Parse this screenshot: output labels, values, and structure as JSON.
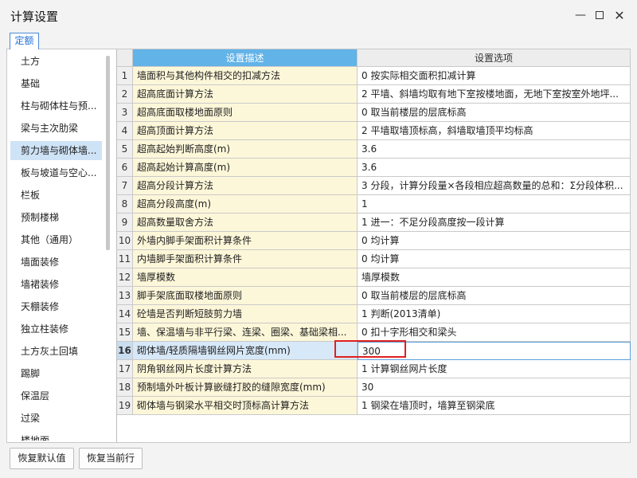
{
  "window": {
    "title": "计算设置"
  },
  "tab": {
    "label": "定额"
  },
  "sidebar": {
    "items": [
      "土方",
      "基础",
      "柱与砌体柱与预...",
      "梁与主次肋梁",
      "剪力墙与砌体墙...",
      "板与坡道与空心...",
      "栏板",
      "预制楼梯",
      "其他（通用）",
      "墙面装修",
      "墙裙装修",
      "天棚装修",
      "独立柱装修",
      "土方灰土回填",
      "踢脚",
      "保温层",
      "过梁",
      "楼地面"
    ],
    "selected_index": 4
  },
  "grid": {
    "headers": {
      "num": "",
      "desc": "设置描述",
      "opt": "设置选项"
    },
    "selected_row": 16,
    "rows": [
      {
        "n": "1",
        "desc": "墙面积与其他构件相交的扣减方法",
        "opt": "0 按实际相交面积扣减计算"
      },
      {
        "n": "2",
        "desc": "超高底面计算方法",
        "opt": "2 平墙、斜墙均取有地下室按楼地面，无地下室按室外地坪..."
      },
      {
        "n": "3",
        "desc": "超高底面取楼地面原则",
        "opt": "0 取当前楼层的层底标高"
      },
      {
        "n": "4",
        "desc": "超高顶面计算方法",
        "opt": "2 平墙取墙顶标高，斜墙取墙顶平均标高"
      },
      {
        "n": "5",
        "desc": "超高起始判断高度(m)",
        "opt": "3.6"
      },
      {
        "n": "6",
        "desc": "超高起始计算高度(m)",
        "opt": "3.6"
      },
      {
        "n": "7",
        "desc": "超高分段计算方法",
        "opt": "3 分段，计算分段量×各段相应超高数量的总和：Σ分段体积..."
      },
      {
        "n": "8",
        "desc": "超高分段高度(m)",
        "opt": "1"
      },
      {
        "n": "9",
        "desc": "超高数量取舍方法",
        "opt": "1 进一：不足分段高度按一段计算"
      },
      {
        "n": "10",
        "desc": "外墙内脚手架面积计算条件",
        "opt": "0 均计算"
      },
      {
        "n": "11",
        "desc": "内墙脚手架面积计算条件",
        "opt": "0 均计算"
      },
      {
        "n": "12",
        "desc": "墙厚模数",
        "opt": "墙厚模数"
      },
      {
        "n": "13",
        "desc": "脚手架底面取楼地面原则",
        "opt": "0 取当前楼层的层底标高"
      },
      {
        "n": "14",
        "desc": "砼墙是否判断短肢剪力墙",
        "opt": "1 判断(2013清单)"
      },
      {
        "n": "15",
        "desc": "墙、保温墙与非平行梁、连梁、圈梁、基础梁相...",
        "opt": "0 扣十字形相交和梁头"
      },
      {
        "n": "16",
        "desc": "砌体墙/轻质隔墙钢丝网片宽度(mm)",
        "opt": "300"
      },
      {
        "n": "17",
        "desc": "阴角钢丝网片长度计算方法",
        "opt": "1 计算钢丝网片长度"
      },
      {
        "n": "18",
        "desc": "预制墙外叶板计算嵌缝打胶的缝隙宽度(mm)",
        "opt": "30"
      },
      {
        "n": "19",
        "desc": "砌体墙与钢梁水平相交时顶标高计算方法",
        "opt": "1 钢梁在墙顶时，墙算至钢梁底"
      }
    ]
  },
  "buttons": {
    "restore_default": "恢复默认值",
    "restore_current": "恢复当前行"
  },
  "colors": {
    "header_accent": "#62b3e8",
    "desc_bg": "#fdf7d9",
    "highlight": "#e02020",
    "selected_side": "#cfe3f7"
  },
  "icons": {
    "minimize": "minimize-icon",
    "maximize": "maximize-icon",
    "close": "close-icon"
  }
}
